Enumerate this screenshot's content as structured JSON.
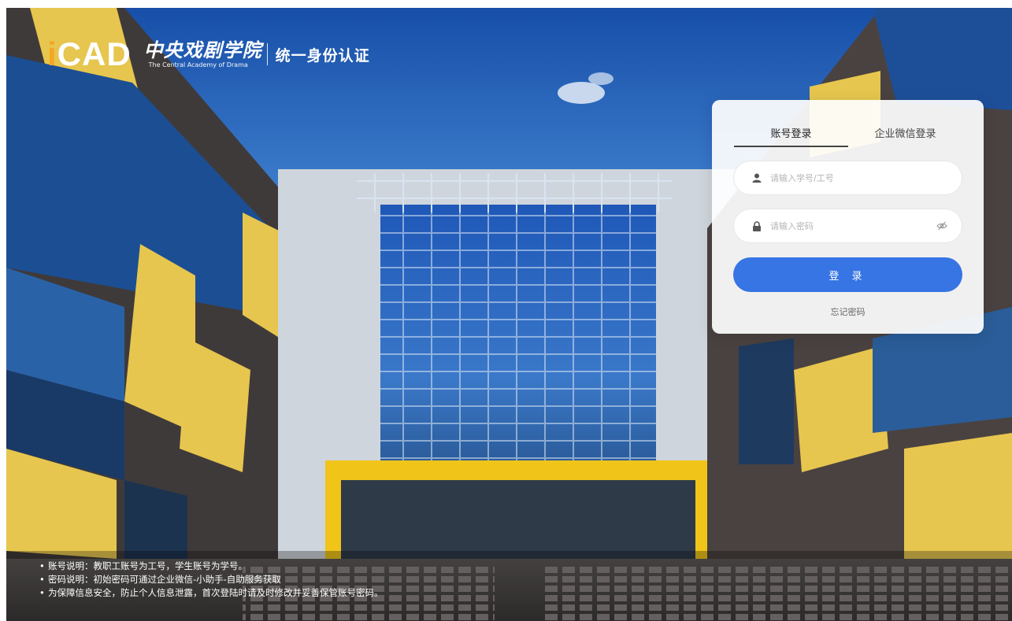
{
  "header": {
    "logo_icad": "iCAD",
    "school_cn": "中央戏剧学院",
    "school_en": "The Central Academy of Drama",
    "system_title": "统一身份认证"
  },
  "login": {
    "tabs": [
      {
        "label": "账号登录",
        "active": true
      },
      {
        "label": "企业微信登录",
        "active": false
      }
    ],
    "username": {
      "value": "",
      "placeholder": "请输入学号/工号",
      "icon": "user-icon"
    },
    "password": {
      "value": "",
      "placeholder": "请输入密码",
      "icon": "lock-icon",
      "toggle_icon": "eye-off-icon"
    },
    "submit_label": "登 录",
    "forgot_label": "忘记密码"
  },
  "notes": [
    "账号说明：教职工账号为工号，学生账号为学号。",
    "密码说明：初始密码可通过企业微信-小助手-自助服务获取",
    "为保障信息安全，防止个人信息泄露，首次登陆时请及时修改并妥善保管账号密码。"
  ],
  "colors": {
    "accent": "#3774e4",
    "logo_i": "#f5a623",
    "building_yellow": "#e6c64e"
  }
}
